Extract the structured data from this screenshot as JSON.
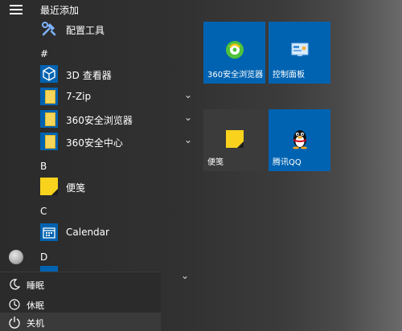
{
  "list": {
    "recent_header": "最近添加",
    "sections": {
      "hash": "#",
      "b": "B",
      "c": "C",
      "d": "D"
    },
    "apps": {
      "config_tools": "配置工具",
      "viewer_3d": "3D 查看器",
      "zip": "7-Zip",
      "browser_360": "360安全浏览器",
      "security_360": "360安全中心",
      "sticky": "便笺",
      "calendar": "Calendar"
    }
  },
  "tiles": {
    "browser_360": "360安全浏览器",
    "control_panel": "控制面板",
    "sticky": "便笺",
    "qq": "腾讯QQ"
  },
  "power_menu": {
    "sleep": "睡眠",
    "hibernate": "休眠",
    "shutdown": "关机"
  },
  "colors": {
    "accent": "#0063b1",
    "tile_gray": "#3b3b3b",
    "sticky_yellow": "#f8d21c"
  }
}
